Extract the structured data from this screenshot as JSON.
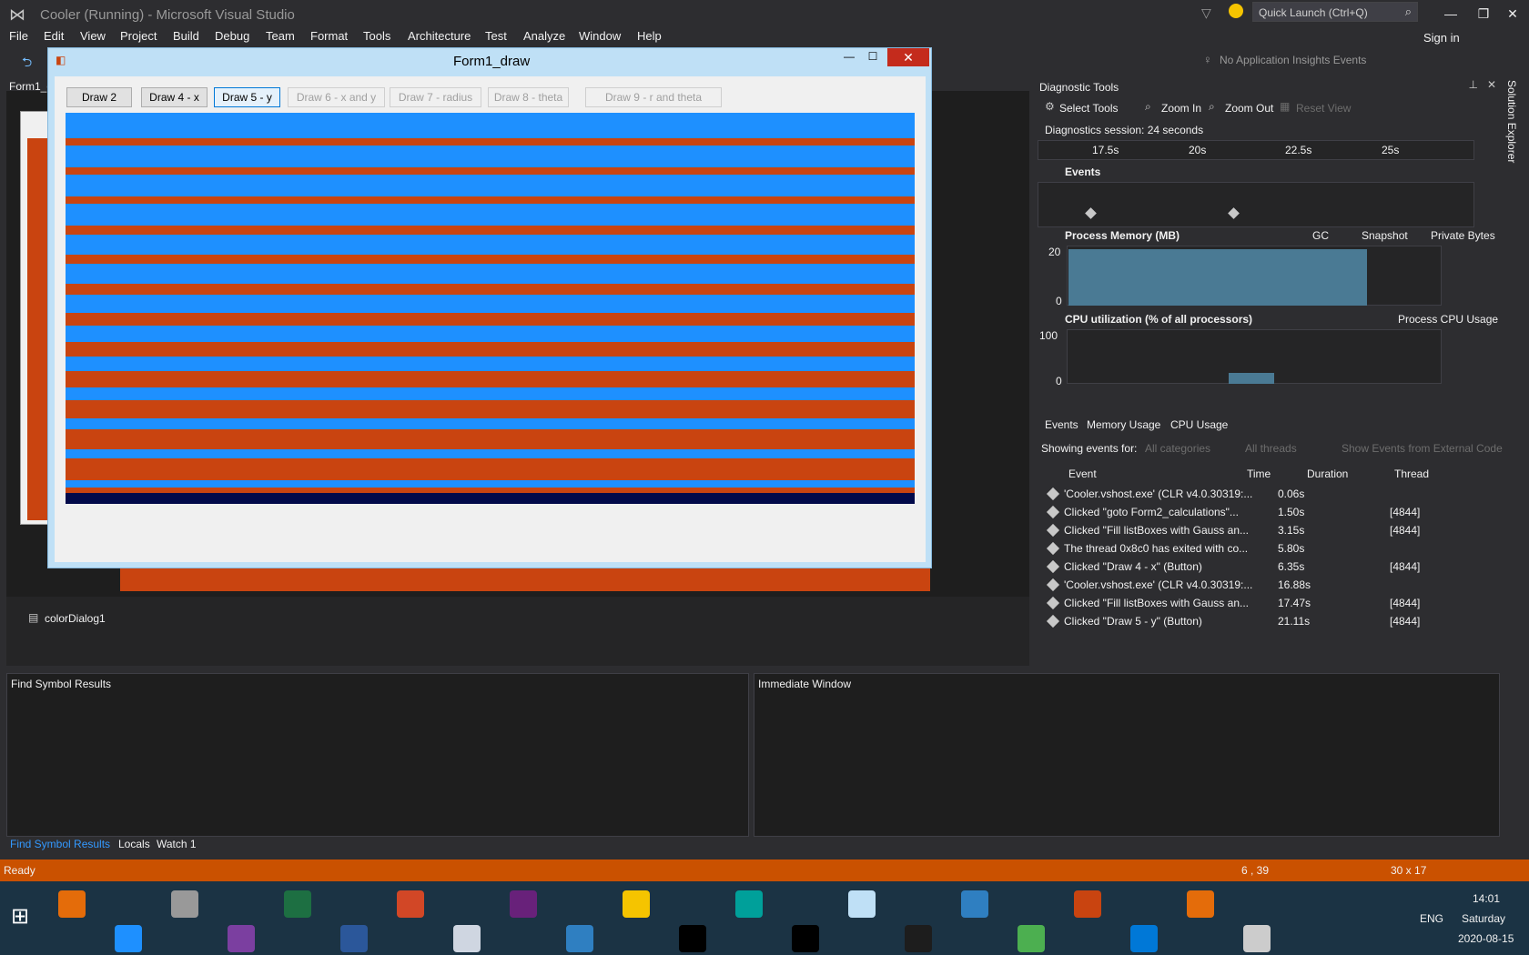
{
  "window": {
    "title": "Cooler (Running) - Microsoft Visual Studio",
    "quick_launch": "Quick Launch (Ctrl+Q)",
    "sign_in": "Sign in"
  },
  "menu": [
    "File",
    "Edit",
    "View",
    "Project",
    "Build",
    "Debug",
    "Team",
    "Format",
    "Tools",
    "Architecture",
    "Test",
    "Analyze",
    "Window",
    "Help"
  ],
  "toolbar": {
    "insights": "No Application Insights Events"
  },
  "editor": {
    "tab": "Form1_d",
    "component": "colorDialog1"
  },
  "form": {
    "title": "Form1_draw",
    "buttons": [
      {
        "label": "Draw 2",
        "state": "normal"
      },
      {
        "label": "Draw 4 - x",
        "state": "normal"
      },
      {
        "label": "Draw 5 - y",
        "state": "active"
      },
      {
        "label": "Draw 6 - x and y",
        "state": "disabled"
      },
      {
        "label": "Draw 7 - radius",
        "state": "disabled"
      },
      {
        "label": "Draw 8 - theta",
        "state": "disabled"
      },
      {
        "label": "Draw 9 - r and theta",
        "state": "disabled"
      }
    ]
  },
  "diagnostics": {
    "title": "Diagnostic Tools",
    "select_tools": "Select Tools",
    "zoom_in": "Zoom In",
    "zoom_out": "Zoom Out",
    "reset_view": "Reset View",
    "session": "Diagnostics session: 24 seconds",
    "ticks": [
      "17.5s",
      "20s",
      "22.5s",
      "25s"
    ],
    "events_label": "Events",
    "memory_label": "Process Memory (MB)",
    "gc": "GC",
    "snapshot": "Snapshot",
    "private_bytes": "Private Bytes",
    "mem_max": "20",
    "mem_min": "0",
    "cpu_label": "CPU utilization (% of all processors)",
    "cpu_legend": "Process CPU Usage",
    "cpu_max": "100",
    "cpu_min": "0",
    "tabs": [
      "Events",
      "Memory Usage",
      "CPU Usage"
    ],
    "showing_for": "Showing events for:",
    "categories": "All categories",
    "threads": "All threads",
    "external": "Show Events from External Code",
    "columns": [
      "Event",
      "Time",
      "Duration",
      "Thread"
    ],
    "rows": [
      [
        "'Cooler.vshost.exe' (CLR v4.0.30319:...",
        "0.06s",
        ""
      ],
      [
        "Clicked \"goto Form2_calculations\"...",
        "1.50s",
        "[4844]"
      ],
      [
        "Clicked \"Fill listBoxes with Gauss an...",
        "3.15s",
        "[4844]"
      ],
      [
        "The thread 0x8c0 has exited with co...",
        "5.80s",
        ""
      ],
      [
        "Clicked \"Draw 4 - x\" (Button)",
        "6.35s",
        "[4844]"
      ],
      [
        "'Cooler.vshost.exe' (CLR v4.0.30319:...",
        "16.88s",
        ""
      ],
      [
        "Clicked \"Fill listBoxes with Gauss an...",
        "17.47s",
        "[4844]"
      ],
      [
        "Clicked \"Draw 5 - y\" (Button)",
        "21.11s",
        "[4844]"
      ]
    ]
  },
  "find_symbol": {
    "title": "Find Symbol Results"
  },
  "immediate": {
    "title": "Immediate Window"
  },
  "bottom_tabs": [
    "Find Symbol Results",
    "Locals",
    "Watch 1"
  ],
  "solution_explorer": "Solution Explorer",
  "status": {
    "text": "Ready",
    "position": "6 , 39",
    "size": "30 x 17"
  },
  "taskbar": {
    "lang": "ENG",
    "time": "14:01",
    "day": "Saturday",
    "date": "2020-08-15"
  }
}
